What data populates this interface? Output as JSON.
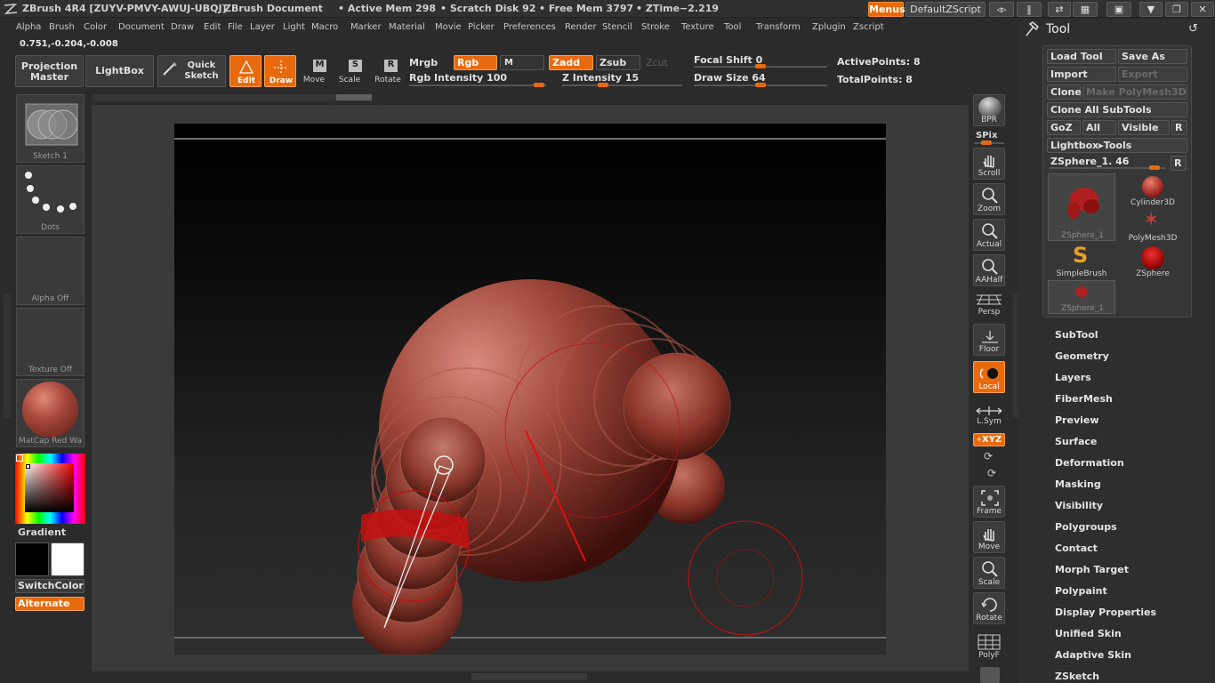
{
  "titlebar": {
    "app": "ZBrush 4R4 [ZUYV-PMVY-AWUJ-UBQJ]",
    "document": "ZBrush Document",
    "active_mem": "• Active Mem 298",
    "scratch": "• Scratch Disk 92",
    "free_mem": "• Free Mem 3797",
    "ztime": "• ZTime−2.219",
    "menus_btn": "Menus",
    "script_btn": "DefaultZScript"
  },
  "menubar": {
    "items": [
      "Alpha",
      "Brush",
      "Color",
      "Document",
      "Draw",
      "Edit",
      "File",
      "Layer",
      "Light",
      "Macro",
      "Marker",
      "Material",
      "Movie",
      "Picker",
      "Preferences",
      "Render",
      "Stencil",
      "Stroke",
      "Texture",
      "Tool",
      "Transform",
      "Zplugin",
      "Zscript"
    ]
  },
  "coords": "0.751,-0.204,-0.008",
  "shelf": {
    "projection_master": "Projection Master",
    "lightbox": "LightBox",
    "quick_sketch": "Quick Sketch",
    "edit": "Edit",
    "draw": "Draw",
    "move": "Move",
    "scale": "Scale",
    "rotate": "Rotate",
    "mrgb": "Mrgb",
    "rgb": "Rgb",
    "m": "M",
    "zadd": "Zadd",
    "zsub": "Zsub",
    "zcut": "Zcut",
    "rgb_intensity": "Rgb Intensity 100",
    "z_intensity": "Z Intensity 15",
    "focal_shift": "Focal Shift 0",
    "draw_size": "Draw Size 64",
    "active_points": "ActivePoints: 8",
    "total_points": "TotalPoints: 8"
  },
  "left": {
    "stroke": "Sketch 1",
    "brush_alpha": "Dots",
    "alpha": "Alpha Off",
    "texture": "Texture Off",
    "material": "MatCap Red Wa",
    "gradient": "Gradient",
    "switch_color": "SwitchColor",
    "alternate": "Alternate"
  },
  "right_tools": {
    "bpr": "BPR",
    "spix": "SPix",
    "scroll": "Scroll",
    "zoom": "Zoom",
    "actual": "Actual",
    "aahalf": "AAHalf",
    "persp": "Persp",
    "floor": "Floor",
    "local": "Local",
    "lsym": "L.Sym",
    "xyz": "∘XYZ",
    "frame": "Frame",
    "move": "Move",
    "scale": "Scale",
    "rotate": "Rotate",
    "polyf": "PolyF"
  },
  "tool_panel": {
    "title": "Tool",
    "load_tool": "Load Tool",
    "save_as": "Save As",
    "import": "Import",
    "export": "Export",
    "clone": "Clone",
    "make_polymesh": "Make PolyMesh3D",
    "clone_all": "Clone All SubTools",
    "goz": "GoZ",
    "all": "All",
    "visible": "Visible",
    "r": "R",
    "lightbox_tools": "Lightbox▸Tools",
    "current_tool": "ZSphere_1. 46",
    "thumbs": [
      "ZSphere_1",
      "Cylinder3D",
      "PolyMesh3D",
      "SimpleBrush",
      "ZSphere",
      "ZSphere_1"
    ],
    "sections": [
      "SubTool",
      "Geometry",
      "Layers",
      "FiberMesh",
      "Preview",
      "Surface",
      "Deformation",
      "Masking",
      "Visibility",
      "Polygroups",
      "Contact",
      "Morph Target",
      "Polypaint",
      "Display Properties",
      "Unified Skin",
      "Adaptive Skin",
      "ZSketch"
    ]
  },
  "colors": {
    "accent": "#e86a0c",
    "sphere": "#a8483c",
    "stroke_red": "#d01010"
  }
}
